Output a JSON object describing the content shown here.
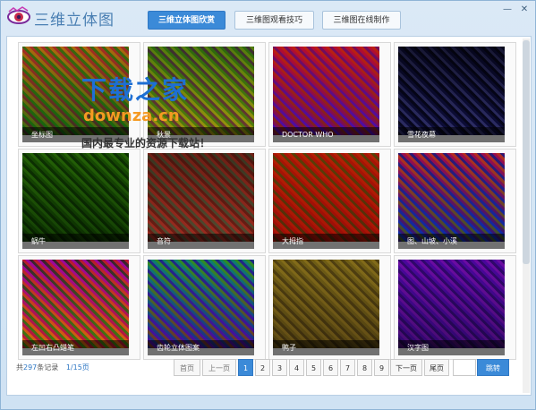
{
  "app": {
    "title": "三维立体图"
  },
  "tabs": [
    {
      "label": "三维立体图欣赏"
    },
    {
      "label": "三维图观看技巧"
    },
    {
      "label": "三维图在线制作"
    }
  ],
  "window_controls": {
    "minimize": "—",
    "close": "✕"
  },
  "gallery": [
    {
      "caption": "坐标图",
      "c1": "#d2a23c",
      "c2": "#c94a8f",
      "c3": "#4aa03c"
    },
    {
      "caption": "秋景",
      "c1": "#6ba23a",
      "c2": "#8c4bd0",
      "c3": "#c7c23a"
    },
    {
      "caption": "DOCTOR WHO",
      "c1": "#d63a6c",
      "c2": "#e08a2a",
      "c3": "#8a3ad0"
    },
    {
      "caption": "雪花夜幕",
      "c1": "#1e1e3c",
      "c2": "#c8c8d8",
      "c3": "#3a3a7a"
    },
    {
      "caption": "蜗牛",
      "c1": "#4d8a1e",
      "c2": "#7ab43a",
      "c3": "#2a5a12"
    },
    {
      "caption": "音符",
      "c1": "#8a4a3a",
      "c2": "#6ab48a",
      "c3": "#c86a5a"
    },
    {
      "caption": "大拇指",
      "c1": "#d65a1e",
      "c2": "#6ab43a",
      "c3": "#c83a2a"
    },
    {
      "caption": "图、山坡、小溪",
      "c1": "#c83a8a",
      "c2": "#e8c23a",
      "c3": "#3a6ad0"
    },
    {
      "caption": "左凹右凸蜡笔",
      "c1": "#c82ac8",
      "c2": "#4ac83a",
      "c3": "#e8a23a"
    },
    {
      "caption": "齿轮立体图案",
      "c1": "#3ab4a8",
      "c2": "#c8c83a",
      "c3": "#8a3ac8"
    },
    {
      "caption": "鸭子",
      "c1": "#a89a4a",
      "c2": "#c8b45a",
      "c3": "#7a6a3a"
    },
    {
      "caption": "汉字图",
      "c1": "#8a2ac8",
      "c2": "#c84ad0",
      "c3": "#5a2a8a"
    }
  ],
  "pager": {
    "prefix": "共",
    "total": "297",
    "suffix": "条记录",
    "page_info": "1/15页",
    "first": "首页",
    "prev": "上一页",
    "pages": [
      "1",
      "2",
      "3",
      "4",
      "5",
      "6",
      "7",
      "8",
      "9"
    ],
    "next": "下一页",
    "last": "尾页",
    "jump": "跳转",
    "jump_value": ""
  },
  "watermark": {
    "line1": "下载之家",
    "line2": "downza.cn",
    "line3": "国内最专业的资源下载站！"
  }
}
